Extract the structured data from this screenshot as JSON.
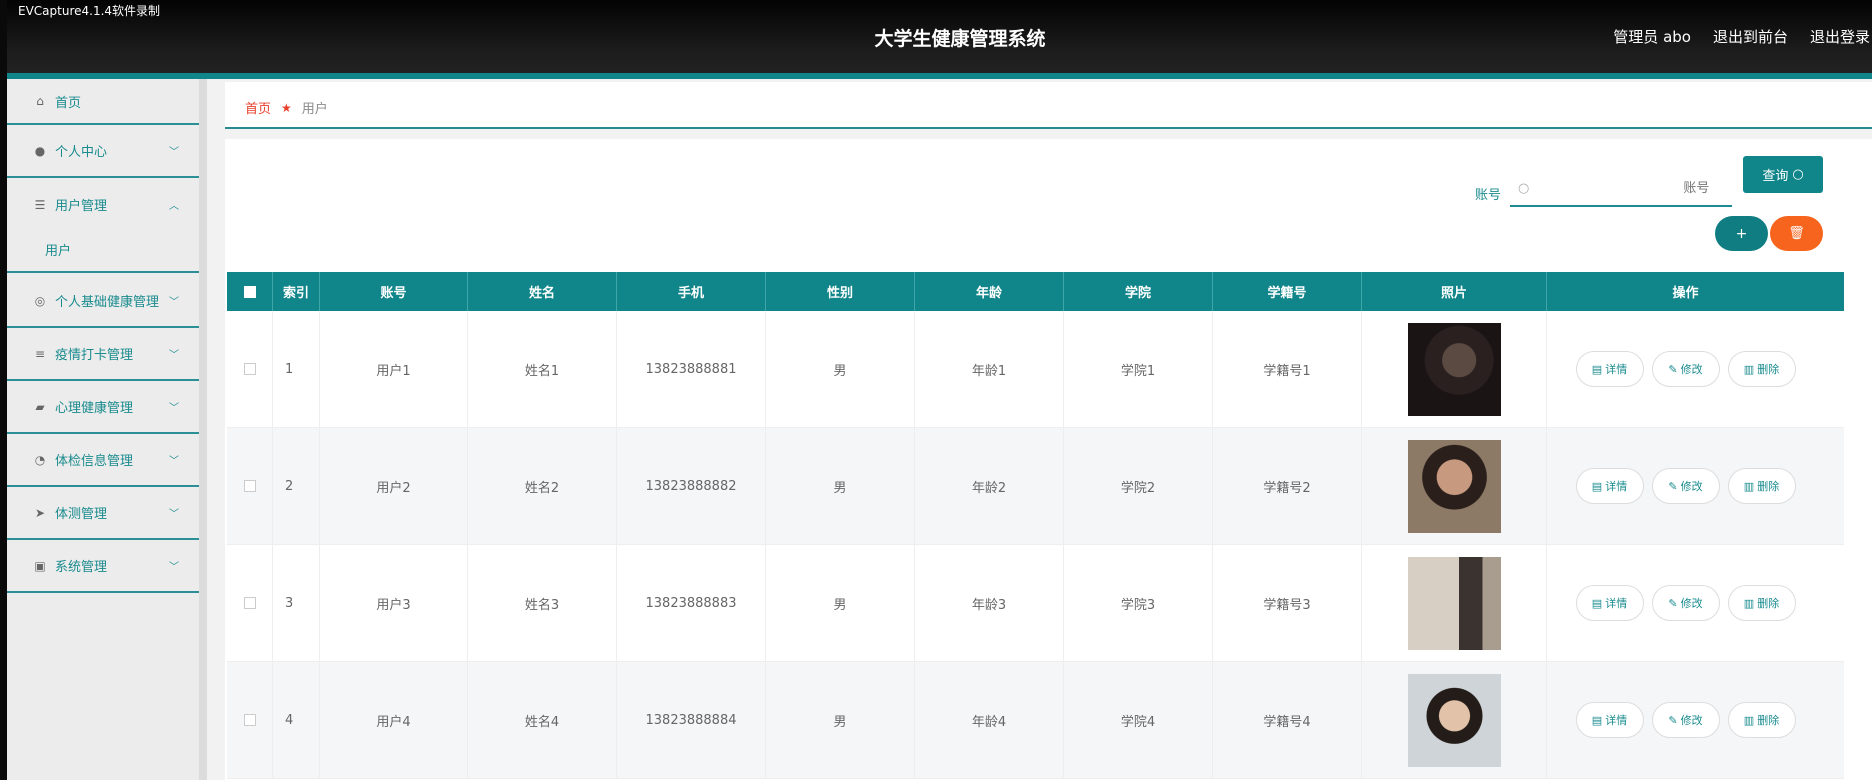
{
  "recorder_label": "EVCapture4.1.4软件录制",
  "header": {
    "title": "大学生健康管理系统",
    "admin_label": "管理员 abo",
    "exit_front": "退出到前台",
    "logout": "退出登录"
  },
  "sidebar": {
    "items": [
      {
        "label": "首页",
        "icon": "home-icon"
      },
      {
        "label": "个人中心",
        "icon": "user-icon"
      },
      {
        "label": "用户管理",
        "icon": "sliders-icon"
      },
      {
        "label": "用户",
        "icon": ""
      },
      {
        "label": "个人基础健康管理",
        "icon": "dashboard-icon"
      },
      {
        "label": "疫情打卡管理",
        "icon": "list-icon"
      },
      {
        "label": "心理健康管理",
        "icon": "chat-icon"
      },
      {
        "label": "体检信息管理",
        "icon": "gauge-icon"
      },
      {
        "label": "体测管理",
        "icon": "send-icon"
      },
      {
        "label": "系统管理",
        "icon": "clipboard-icon"
      }
    ]
  },
  "breadcrumb": {
    "home": "首页",
    "current": "用户"
  },
  "search": {
    "label": "账号",
    "placeholder": "账号",
    "button": "查询"
  },
  "table": {
    "headers": [
      "索引",
      "账号",
      "姓名",
      "手机",
      "性别",
      "年龄",
      "学院",
      "学籍号",
      "照片",
      "操作"
    ],
    "rows": [
      {
        "index": "1",
        "account": "用户1",
        "name": "姓名1",
        "phone": "13823888881",
        "gender": "男",
        "age": "年龄1",
        "college": "学院1",
        "student_no": "学籍号1"
      },
      {
        "index": "2",
        "account": "用户2",
        "name": "姓名2",
        "phone": "13823888882",
        "gender": "男",
        "age": "年龄2",
        "college": "学院2",
        "student_no": "学籍号2"
      },
      {
        "index": "3",
        "account": "用户3",
        "name": "姓名3",
        "phone": "13823888883",
        "gender": "男",
        "age": "年龄3",
        "college": "学院3",
        "student_no": "学籍号3"
      },
      {
        "index": "4",
        "account": "用户4",
        "name": "姓名4",
        "phone": "13823888884",
        "gender": "男",
        "age": "年龄4",
        "college": "学院4",
        "student_no": "学籍号4"
      }
    ],
    "actions": {
      "detail": "详情",
      "edit": "修改",
      "delete": "删除"
    }
  },
  "colors": {
    "accent": "#11868a",
    "danger": "#f6641d",
    "breadcrumb_home": "#e8402c"
  }
}
